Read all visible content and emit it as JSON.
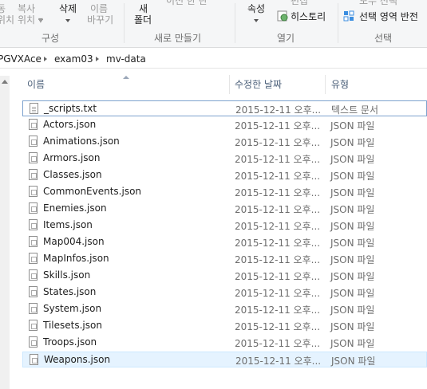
{
  "ribbon": {
    "move_cut": "동",
    "move_cut2": "위치",
    "copy_to": "복사",
    "copy_to2": "위치 ▾",
    "delete": "삭제",
    "rename": "이름",
    "rename2": "바꾸기",
    "new_folder": "새",
    "new_folder2": "폴더",
    "easy_access": "이전 한 란",
    "properties": "속성",
    "edit": "편집",
    "history": "히스토리",
    "select_all": "모두 선택",
    "invert_selection": "선택 영역 반전",
    "groups": {
      "organize": "구성",
      "new": "새로 만들기",
      "open": "열기",
      "select": "선택"
    }
  },
  "address": {
    "crumbs": [
      "PGVXAce",
      "exam03",
      "mv-data"
    ]
  },
  "columns": {
    "name": "이름",
    "modified": "수정한 날짜",
    "type": "유형"
  },
  "files": [
    {
      "name": "_scripts.txt",
      "date": "2015-12-11 오후...",
      "type": "텍스트 문서",
      "icon": "text-file-icon"
    },
    {
      "name": "Actors.json",
      "date": "2015-12-11 오후...",
      "type": "JSON 파일",
      "icon": "json-file-icon"
    },
    {
      "name": "Animations.json",
      "date": "2015-12-11 오후...",
      "type": "JSON 파일",
      "icon": "json-file-icon"
    },
    {
      "name": "Armors.json",
      "date": "2015-12-11 오후...",
      "type": "JSON 파일",
      "icon": "json-file-icon"
    },
    {
      "name": "Classes.json",
      "date": "2015-12-11 오후...",
      "type": "JSON 파일",
      "icon": "json-file-icon"
    },
    {
      "name": "CommonEvents.json",
      "date": "2015-12-11 오후...",
      "type": "JSON 파일",
      "icon": "json-file-icon"
    },
    {
      "name": "Enemies.json",
      "date": "2015-12-11 오후...",
      "type": "JSON 파일",
      "icon": "json-file-icon"
    },
    {
      "name": "Items.json",
      "date": "2015-12-11 오후...",
      "type": "JSON 파일",
      "icon": "json-file-icon"
    },
    {
      "name": "Map004.json",
      "date": "2015-12-11 오후...",
      "type": "JSON 파일",
      "icon": "json-file-icon"
    },
    {
      "name": "MapInfos.json",
      "date": "2015-12-11 오후...",
      "type": "JSON 파일",
      "icon": "json-file-icon"
    },
    {
      "name": "Skills.json",
      "date": "2015-12-11 오후...",
      "type": "JSON 파일",
      "icon": "json-file-icon"
    },
    {
      "name": "States.json",
      "date": "2015-12-11 오후...",
      "type": "JSON 파일",
      "icon": "json-file-icon"
    },
    {
      "name": "System.json",
      "date": "2015-12-11 오후...",
      "type": "JSON 파일",
      "icon": "json-file-icon"
    },
    {
      "name": "Tilesets.json",
      "date": "2015-12-11 오후...",
      "type": "JSON 파일",
      "icon": "json-file-icon"
    },
    {
      "name": "Troops.json",
      "date": "2015-12-11 오후...",
      "type": "JSON 파일",
      "icon": "json-file-icon"
    },
    {
      "name": "Weapons.json",
      "date": "2015-12-11 오후...",
      "type": "JSON 파일",
      "icon": "json-file-icon"
    }
  ],
  "colors": {
    "selection_bg": "#e5f3ff",
    "focus_border": "#7da2ce",
    "header_text": "#4c607a"
  }
}
